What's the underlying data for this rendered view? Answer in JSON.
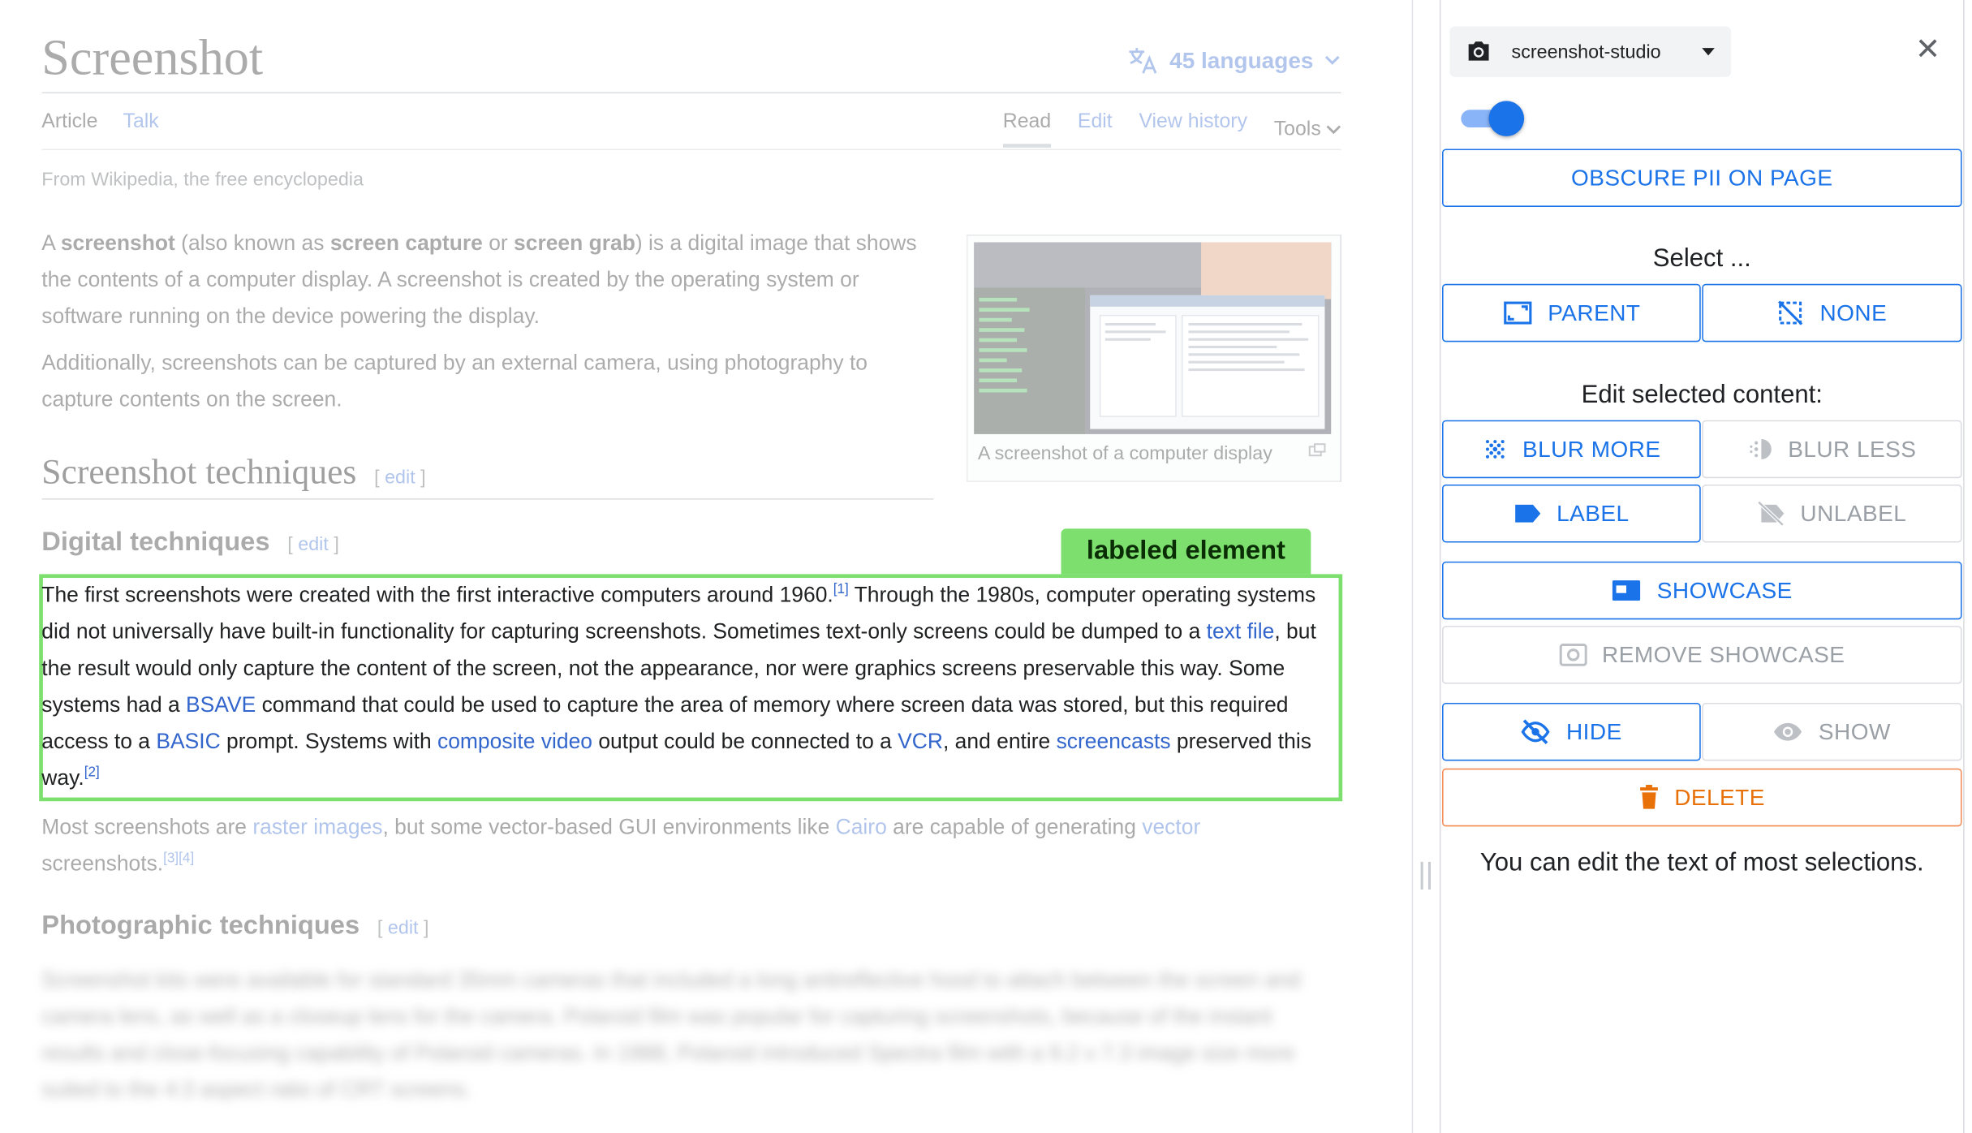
{
  "article": {
    "title": "Screenshot",
    "languages": "45 languages",
    "tabs_left": [
      "Article",
      "Talk"
    ],
    "tabs_right": [
      "Read",
      "Edit",
      "View history",
      "Tools"
    ],
    "from": "From Wikipedia, the free encyclopedia",
    "intro": {
      "p1_a": "A ",
      "p1_b1": "screenshot",
      "p1_c": " (also known as ",
      "p1_b2": "screen capture",
      "p1_d": " or ",
      "p1_b3": "screen grab",
      "p1_e": ") is a digital image that shows the contents of a computer display. A screenshot is created by the operating system or software running on the device powering the display.",
      "p2": "Additionally, screenshots can be captured by an external camera, using photography to capture contents on the screen."
    },
    "thumb_caption": "A screenshot of a computer display",
    "section_techniques": "Screenshot techniques",
    "edit_word": "edit",
    "bracket_open": "[",
    "bracket_close": "]",
    "section_digital": "Digital techniques",
    "label_tag": "labeled element",
    "focus": {
      "t1": "The first screenshots were created with the first interactive computers around 1960.",
      "ref1": "[1]",
      "t2": " Through the 1980s, computer operating systems did not universally have built-in functionality for capturing screenshots. Sometimes text-only screens could be dumped to a ",
      "l1": "text file",
      "t3": ", but the result would only capture the content of the screen, not the appearance, nor were graphics screens preservable this way. Some systems had a ",
      "l2": "BSAVE",
      "t4": " command that could be used to capture the area of memory where screen data was stored, but this required access to a ",
      "l3": "BASIC",
      "t5": " prompt. Systems with ",
      "l4": "composite video",
      "t6": " output could be connected to a ",
      "l5": "VCR",
      "t7": ", and entire ",
      "l6": "screencasts",
      "t8": " preserved this way.",
      "ref2": "[2]"
    },
    "after": {
      "t1": "Most screenshots are ",
      "l1": "raster images",
      "t2": ", but some vector-based GUI environments like ",
      "l2": "Cairo",
      "t3": " are capable of generating ",
      "l3": "vector",
      "t4": " screenshots.",
      "refs": "[3][4]"
    },
    "section_photo": "Photographic techniques",
    "blurred_text": "Screenshot kits were available for standard 35mm cameras that included a long antireflective hood to attach between the screen and camera lens, as well as a closeup lens for the camera. Polaroid film was popular for capturing screenshots, because of the instant results and close-focusing capability of Polaroid cameras. In 1988, Polaroid introduced Spectra film with a 9.2 x 7.3 image size more suited to the 4:3 aspect ratio of CRT screens."
  },
  "panel": {
    "extension_name": "screenshot-studio",
    "toggle_on": true,
    "obscure_label": "OBSCURE PII ON PAGE",
    "select_label": "Select ...",
    "parent_label": "PARENT",
    "none_label": "NONE",
    "edit_label": "Edit selected content:",
    "blur_more": "BLUR MORE",
    "blur_less": "BLUR LESS",
    "label": "LABEL",
    "unlabel": "UNLABEL",
    "showcase": "SHOWCASE",
    "remove_showcase": "REMOVE SHOWCASE",
    "hide": "HIDE",
    "show": "SHOW",
    "delete": "DELETE",
    "hint": "You can edit the text of most selections."
  },
  "colors": {
    "accent": "#1a73e8",
    "label_green": "#7de06e",
    "danger": "#e8710a",
    "link": "#3366cc"
  }
}
